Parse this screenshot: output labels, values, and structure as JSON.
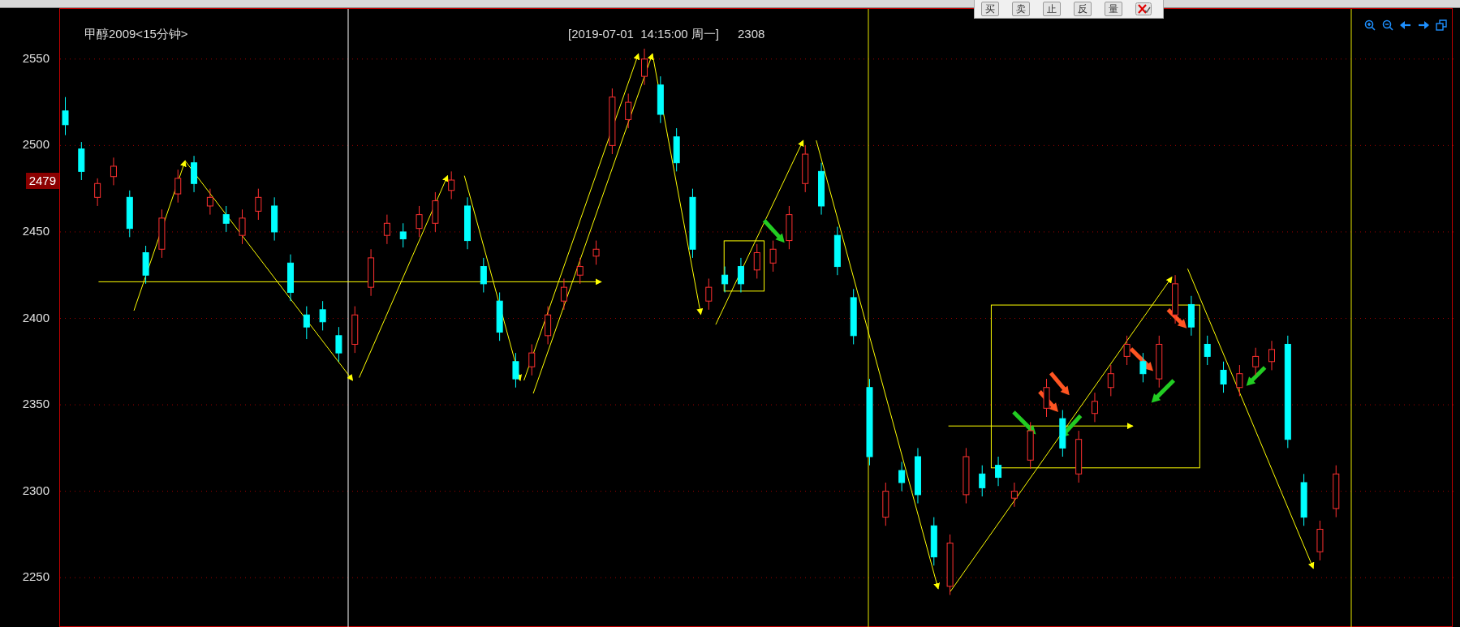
{
  "chart": {
    "title": "甲醇2009<15分钟>",
    "cursor_time": "[2019-07-01  14:15:00 周一]",
    "cursor_value": "2308",
    "price_tag": "2479",
    "chart_data": {
      "type": "candlestick",
      "grid": true,
      "ylim": [
        2221,
        2579
      ],
      "yticks": [
        2250,
        2300,
        2350,
        2400,
        2450,
        2500,
        2550
      ],
      "ohlc": [
        [
          2520,
          2528,
          2506,
          2512
        ],
        [
          2498,
          2502,
          2480,
          2485
        ],
        [
          2470,
          2481,
          2465,
          2478
        ],
        [
          2482,
          2493,
          2477,
          2488
        ],
        [
          2470,
          2474,
          2447,
          2452
        ],
        [
          2438,
          2442,
          2420,
          2425
        ],
        [
          2440,
          2463,
          2435,
          2458
        ],
        [
          2472,
          2486,
          2467,
          2481
        ],
        [
          2490,
          2494,
          2473,
          2478
        ],
        [
          2465,
          2475,
          2460,
          2470
        ],
        [
          2460,
          2465,
          2450,
          2455
        ],
        [
          2448,
          2463,
          2443,
          2458
        ],
        [
          2462,
          2475,
          2457,
          2470
        ],
        [
          2465,
          2470,
          2445,
          2450
        ],
        [
          2432,
          2437,
          2410,
          2415
        ],
        [
          2402,
          2407,
          2388,
          2395
        ],
        [
          2405,
          2410,
          2393,
          2398
        ],
        [
          2390,
          2395,
          2375,
          2380
        ],
        [
          2385,
          2407,
          2380,
          2402
        ],
        [
          2418,
          2440,
          2413,
          2435
        ],
        [
          2448,
          2460,
          2443,
          2455
        ],
        [
          2450,
          2455,
          2441,
          2446
        ],
        [
          2452,
          2465,
          2447,
          2460
        ],
        [
          2455,
          2473,
          2450,
          2468
        ],
        [
          2474,
          2485,
          2469,
          2480
        ],
        [
          2465,
          2470,
          2440,
          2445
        ],
        [
          2430,
          2435,
          2415,
          2420
        ],
        [
          2410,
          2415,
          2387,
          2392
        ],
        [
          2375,
          2380,
          2360,
          2365
        ],
        [
          2372,
          2385,
          2367,
          2380
        ],
        [
          2390,
          2407,
          2385,
          2402
        ],
        [
          2410,
          2423,
          2405,
          2418
        ],
        [
          2425,
          2435,
          2420,
          2430
        ],
        [
          2436,
          2445,
          2431,
          2440
        ],
        [
          2500,
          2533,
          2495,
          2528
        ],
        [
          2515,
          2530,
          2510,
          2525
        ],
        [
          2540,
          2556,
          2535,
          2550
        ],
        [
          2535,
          2540,
          2513,
          2518
        ],
        [
          2505,
          2510,
          2485,
          2490
        ],
        [
          2470,
          2475,
          2435,
          2440
        ],
        [
          2410,
          2423,
          2405,
          2418
        ],
        [
          2425,
          2430,
          2415,
          2420
        ],
        [
          2430,
          2435,
          2415,
          2420
        ],
        [
          2428,
          2443,
          2423,
          2438
        ],
        [
          2432,
          2445,
          2427,
          2440
        ],
        [
          2445,
          2465,
          2440,
          2460
        ],
        [
          2478,
          2500,
          2473,
          2495
        ],
        [
          2485,
          2490,
          2460,
          2465
        ],
        [
          2448,
          2453,
          2425,
          2430
        ],
        [
          2412,
          2417,
          2385,
          2390
        ],
        [
          2360,
          2365,
          2315,
          2320
        ],
        [
          2285,
          2305,
          2280,
          2300
        ],
        [
          2312,
          2317,
          2300,
          2305
        ],
        [
          2320,
          2325,
          2293,
          2298
        ],
        [
          2280,
          2285,
          2257,
          2262
        ],
        [
          2245,
          2275,
          2240,
          2270
        ],
        [
          2298,
          2325,
          2293,
          2320
        ],
        [
          2310,
          2315,
          2297,
          2302
        ],
        [
          2315,
          2320,
          2303,
          2308
        ],
        [
          2296,
          2305,
          2291,
          2300
        ],
        [
          2318,
          2340,
          2313,
          2335
        ],
        [
          2348,
          2365,
          2343,
          2360
        ],
        [
          2342,
          2347,
          2320,
          2325
        ],
        [
          2310,
          2335,
          2305,
          2330
        ],
        [
          2345,
          2357,
          2340,
          2352
        ],
        [
          2360,
          2373,
          2355,
          2368
        ],
        [
          2378,
          2390,
          2373,
          2385
        ],
        [
          2375,
          2380,
          2363,
          2368
        ],
        [
          2365,
          2390,
          2360,
          2385
        ],
        [
          2402,
          2425,
          2397,
          2420
        ],
        [
          2408,
          2413,
          2390,
          2395
        ],
        [
          2385,
          2390,
          2373,
          2378
        ],
        [
          2370,
          2375,
          2357,
          2362
        ],
        [
          2360,
          2373,
          2355,
          2368
        ],
        [
          2372,
          2383,
          2367,
          2378
        ],
        [
          2375,
          2387,
          2370,
          2382
        ],
        [
          2385,
          2390,
          2325,
          2330
        ],
        [
          2305,
          2310,
          2280,
          2285
        ],
        [
          2265,
          2283,
          2260,
          2278
        ],
        [
          2290,
          2315,
          2285,
          2310
        ]
      ]
    }
  },
  "toolbar": {
    "buttons": [
      {
        "label": "买"
      },
      {
        "label": "卖"
      },
      {
        "label": "止"
      },
      {
        "label": "反"
      },
      {
        "label": "量"
      }
    ]
  }
}
